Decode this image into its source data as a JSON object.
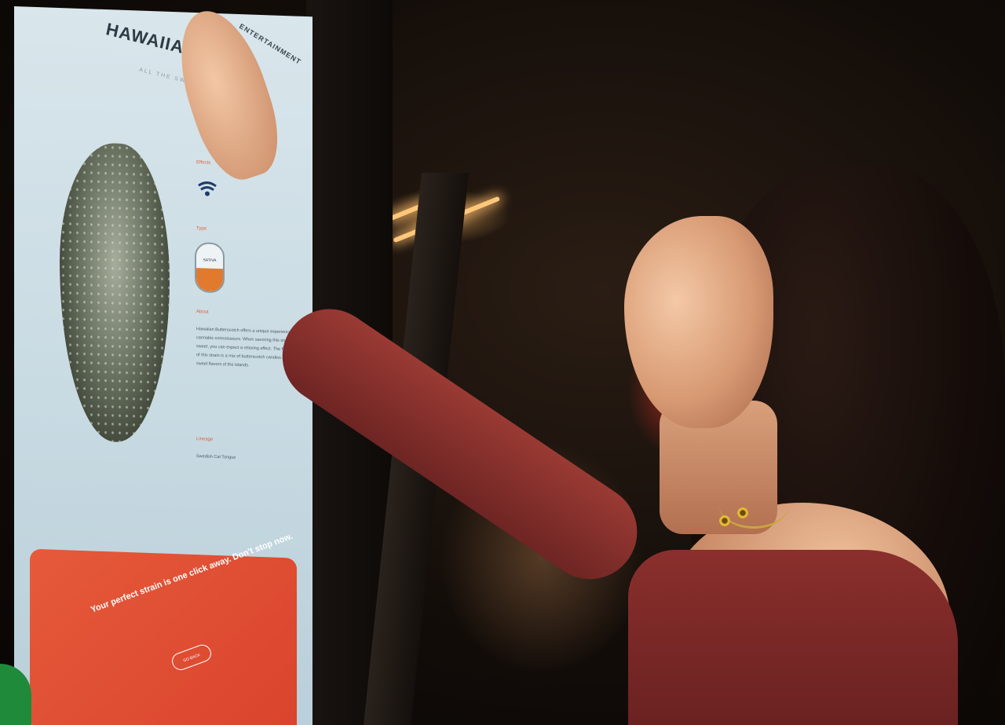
{
  "kiosk": {
    "title": "HAWAIIAN B",
    "subtitle": "ALL THE SWEETS",
    "side_label": "ENTERTAINMENT",
    "section_effects": "Effects",
    "section_type": "Type",
    "type_value": "SATIVA",
    "section_about": "About",
    "about_text": "Hawaiian Butterscotch offers a unique experience to cannabis connoisseurs. When savoring this strain's sweet, you can expect a relaxing effect. The flavor profile of this strain is a mix of butterscotch candies and all with sweet flavors of the islands.",
    "section_lineage": "Lineage",
    "lineage_text": "Swedish Cat Tongue",
    "cta_text": "Your perfect strain is one click away. Don't stop now.",
    "cta_button": "GO BACK"
  },
  "colors": {
    "accent": "#e0603a",
    "screen": "#d3e2e9",
    "brand_green": "#1f8a3a"
  },
  "icons": {
    "effects": "effects-icon",
    "type": "type-dial-icon"
  }
}
